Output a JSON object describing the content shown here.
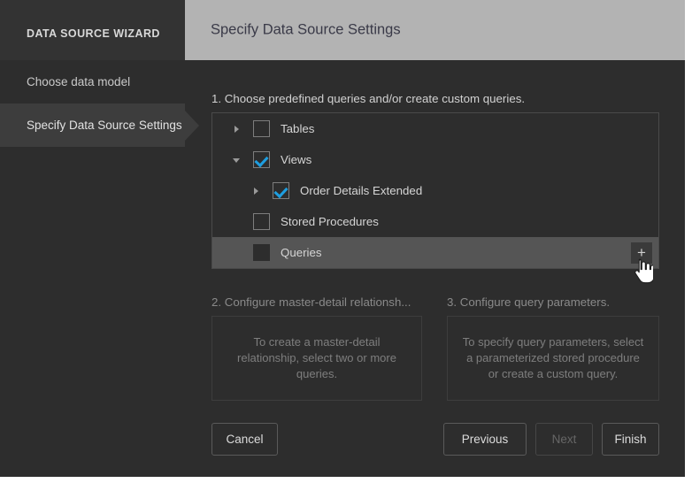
{
  "window": {
    "background": "#2d2d2d",
    "accent_blue": "#1e9ee0"
  },
  "sidebar": {
    "brand": "DATA SOURCE WIZARD",
    "items": [
      {
        "label": "Choose data model",
        "active": false
      },
      {
        "label": "Specify Data Source Settings",
        "active": true
      }
    ]
  },
  "header": {
    "title": "Specify Data Source Settings",
    "background": "#b3b3b3",
    "text_color": "#3a3a48"
  },
  "main": {
    "step1": {
      "label": "1. Choose predefined queries and/or create custom queries.",
      "tree": [
        {
          "label": "Tables",
          "twisty": "collapsed-triangle-icon",
          "checkbox": "unchecked",
          "indent": 0,
          "selected": false
        },
        {
          "label": "Views",
          "twisty": "expanded-triangle-icon",
          "checkbox": "checked",
          "indent": 0,
          "selected": false
        },
        {
          "label": "Order Details Extended",
          "twisty": "collapsed-triangle-icon",
          "checkbox": "checked",
          "indent": 1,
          "selected": false
        },
        {
          "label": "Stored Procedures",
          "twisty": "none",
          "checkbox": "unchecked",
          "indent": 0,
          "selected": false
        },
        {
          "label": "Queries",
          "twisty": "none",
          "checkbox": "blank-filled",
          "indent": 0,
          "selected": true,
          "add_button": "+"
        }
      ]
    },
    "step2": {
      "label": "2. Configure master-detail relationsh...",
      "placeholder": "To create a master-detail relationship, select two or more queries."
    },
    "step3": {
      "label": "3. Configure query parameters.",
      "placeholder": "To specify query parameters, select a parameterized stored procedure or create a custom query."
    }
  },
  "footer": {
    "cancel": "Cancel",
    "previous": "Previous",
    "next": "Next",
    "finish": "Finish",
    "next_disabled": true
  },
  "cursor": {
    "type": "pointing-hand-cursor"
  }
}
